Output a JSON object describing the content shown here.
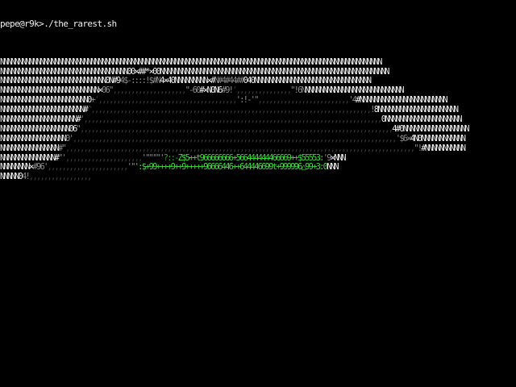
{
  "terminal": {
    "prompt": "pepe@r9k>",
    "command": "./the_rarest.sh",
    "colors": {
      "background": "#000000",
      "text": "#eeeeee",
      "gray": "#8c8c8c",
      "dim": "#5c5c5c",
      "dark": "#3c3c3c",
      "green": "#3ddc3d",
      "bright_green": "#58f058",
      "dark_green": "#33a033"
    },
    "art_lines": [
      {
        "segments": [
          {
            "c": "white",
            "t": "NNNNNNNNNNNNNNNNNNNNNNNNNNNNNNNNNNNNNNNNNNNNNNNNNNNNNNNNNNNNNNNNNNNNNNNNNNNNNNNNNNNNNNNNNNNNNNNNNNNNNNNNN"
          }
        ]
      },
      {
        "segments": [
          {
            "c": "white",
            "t": "NNNNNNNNNNNNNNNNNNNNNNNNNNNNNNNNNNN00×##*×00NNNNNNNNNNNNNNNNNNNNNNNNNNNNNNNNNNNNNNNNNNNNNNNNNNNNNNNNNNNNNNN"
          }
        ]
      },
      {
        "segments": [
          {
            "c": "white",
            "t": "NNNNNNNNNNNNNNNNNNNNNNNNNNNNN0N#9"
          },
          {
            "c": "gray",
            "t": "4$-::::!$#N"
          },
          {
            "c": "white",
            "t": "4×40NNNNNNNNN×#"
          },
          {
            "c": "gray",
            "t": "N#4#44##"
          },
          {
            "c": "white",
            "t": "040NNNNNNNNNNNNNNNNNNNNNNNNNNNNNNNN"
          }
        ]
      },
      {
        "segments": [
          {
            "c": "white",
            "t": "NNNNNNNNNNNNNNNNNNNNNNNNNNN×"
          },
          {
            "c": "gray",
            "t": "06\""
          },
          {
            "c": "dark",
            "t": ",,,,,,,,,,,,,,,,,,,,"
          },
          {
            "c": "gray",
            "t": "\"-60"
          },
          {
            "c": "white",
            "t": "#×N0N6"
          },
          {
            "c": "gray",
            "t": "#9!"
          },
          {
            "c": "dark",
            "t": "',,,,,,,,,,,,,,,"
          },
          {
            "c": "gray",
            "t": "\"!6N"
          },
          {
            "c": "white",
            "t": "NNNNNNNNNNNNNNNNNNNNNNNNNNN"
          }
        ]
      },
      {
        "segments": [
          {
            "c": "white",
            "t": "NNNNNNNNNNNNNNNNNNNNNNNN0"
          },
          {
            "c": "gray",
            "t": "+"
          },
          {
            "c": "dark",
            "t": "',,,,,,,,,,,,,,,,,,,,,,,,,,,,,,,,,,,,,,"
          },
          {
            "c": "gray",
            "t": "':!-'\""
          },
          {
            "c": "dark",
            "t": ",,,,,,,,,,,,,,,,,,,,,,,,,"
          },
          {
            "c": "gray",
            "t": "'4"
          },
          {
            "c": "white",
            "t": "#NNNNNNNNNNNNNNNNNNNNNNNN"
          }
        ]
      },
      {
        "segments": [
          {
            "c": "white",
            "t": "NNNNNNNNNNNNNNNNNNNNNNN#"
          },
          {
            "c": "dark",
            "t": "^,,,,,,,,,,,,,,,,,,,,,,,,,,,,,,,,,,,,,,,,,,,,,,,,,,,,,,,,,,,,,,,,,,,,,,,,,,,,,"
          },
          {
            "c": "gray",
            "t": "!"
          },
          {
            "c": "white",
            "t": "8NNNNNNNNNNNNNNNNNNNNNN"
          }
        ]
      },
      {
        "segments": [
          {
            "c": "white",
            "t": "NNNNNNNNNNNNNNNNNNNNN#"
          },
          {
            "c": "gray",
            "t": "'"
          },
          {
            "c": "dark",
            "t": ",,,,,,,,,,,,,,,,,,,,,,,,,,,,,,,,,,,,,,,,,,,,,,,,,,,,,,,,,,,,,,,,,,,,,,,,,,,,,,,,,,"
          },
          {
            "c": "white",
            "t": "0NNNNNNNNNNNNNNNNNNNNN"
          }
        ]
      },
      {
        "segments": [
          {
            "c": "white",
            "t": "NNNNNNNNNNNNNNNNNNN06"
          },
          {
            "c": "gray",
            "t": "\""
          },
          {
            "c": "dark",
            "t": ",,,,,,,,,,,,,,,,,,,,,,,,,,,,,,,,,,,,,,,,,,,,,,,,,,,,,,,,,,,,,,,,,,,,,,,,,,,,,,,,,,,,,,"
          },
          {
            "c": "white",
            "t": "4#0NNNNNNNNNNNNNNNNNN"
          }
        ]
      },
      {
        "segments": [
          {
            "c": "white",
            "t": "NNNNNNNNNNNNNNNNNN"
          },
          {
            "c": "gray",
            "t": "0'"
          },
          {
            "c": "dark",
            "t": ",,,,,,,,,,,,,,,,,,,,,,,,,,,,,,,,,,,,,,,,,,,,,,,,,,,,,,,,,,,,,,,,,,,,,,,,,,,,,,,,,,,,,,,,,"
          },
          {
            "c": "gray",
            "t": "'$6×"
          },
          {
            "c": "white",
            "t": "4N0NNNNNNNNNNNN"
          }
        ]
      },
      {
        "segments": [
          {
            "c": "white",
            "t": "NNNNNNNNNNNNNNNN"
          },
          {
            "c": "gray",
            "t": "#\""
          },
          {
            "c": "dark",
            "t": ",,,,,,,,,,,,,,,,,,,,,,,,,,,,,,,,,,,,,,,,,,,,,,,,,,,,,,,,,,,,,,,,,,,,,,,,,,,,,,,,,,,,,,,,,,,,,,,,"
          },
          {
            "c": "gray",
            "t": "\"!"
          },
          {
            "c": "white",
            "t": "#NNNNNNNNNNN"
          }
        ]
      },
      {
        "segments": [
          {
            "c": "white",
            "t": "NNNNNNNNNNNNNNN#"
          },
          {
            "c": "gray",
            "t": "\"'"
          },
          {
            "c": "dark",
            "t": ",,,,,,,,,,,,,,,,,,,,,"
          },
          {
            "c": "gray",
            "t": "'\"\"\"\"'"
          },
          {
            "c": "dgreen",
            "t": "?::-"
          },
          {
            "c": "green",
            "t": "Z$5++t966666666+566444444466669++$55553:"
          },
          {
            "c": "gray",
            "t": "'9"
          },
          {
            "c": "white",
            "t": "×NNN"
          }
        ]
      },
      {
        "segments": [
          {
            "c": "white",
            "t": "NNNNNNNN×"
          },
          {
            "c": "gray",
            "t": "#96'"
          },
          {
            "c": "dark",
            "t": ",,,,,,,,,,,,,,,,,,,,,,"
          },
          {
            "c": "gray",
            "t": "'\""
          },
          {
            "c": "green",
            "t": "':$+99++++9++9+++++96666446++644446699t+999996△99+3:0"
          },
          {
            "c": "white",
            "t": "NNN"
          }
        ]
      },
      {
        "segments": [
          {
            "c": "white",
            "t": "NNNNN0"
          },
          {
            "c": "gray",
            "t": "4!"
          },
          {
            "c": "dark",
            "t": ",,,,,,,,,,,,,,,,,"
          }
        ]
      }
    ]
  }
}
